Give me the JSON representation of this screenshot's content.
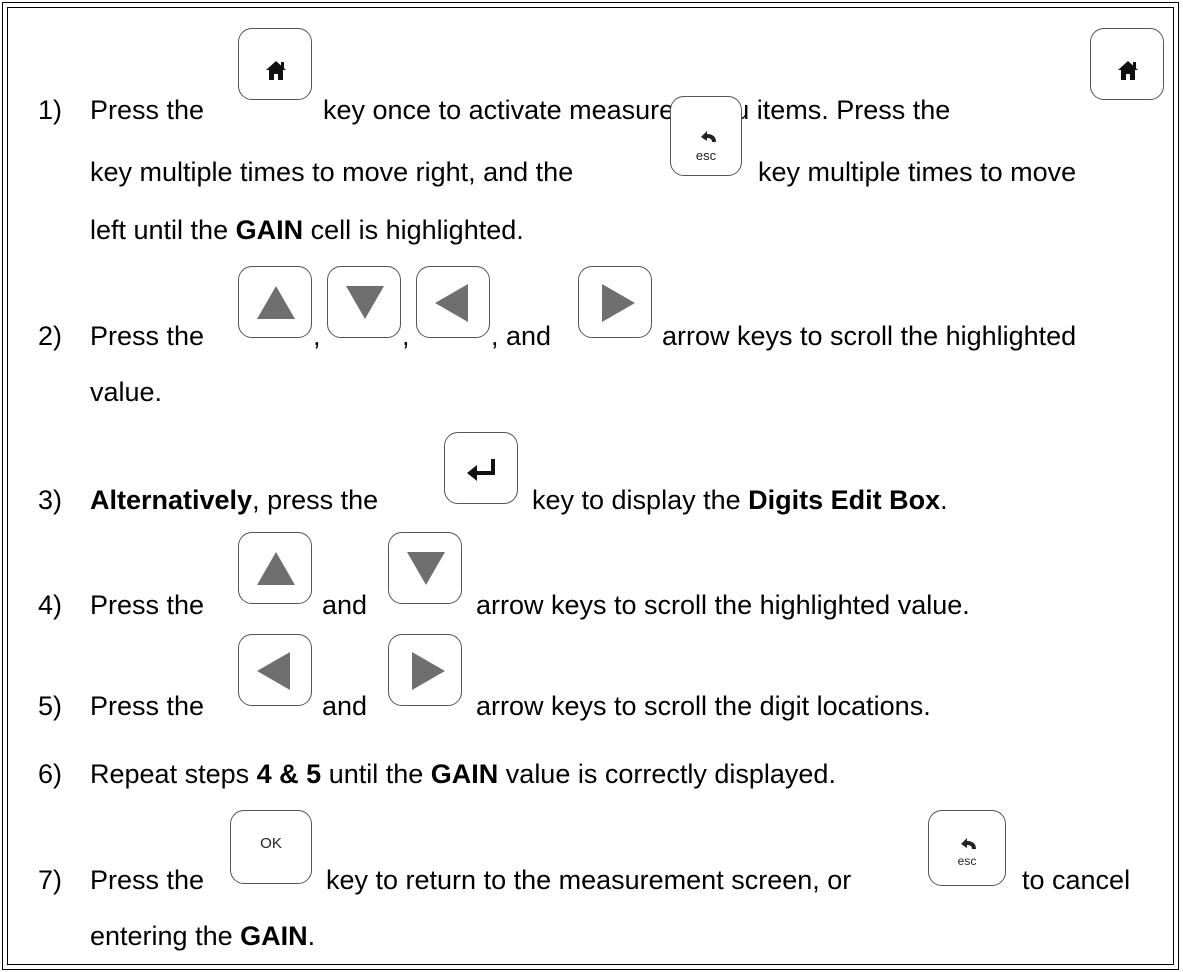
{
  "steps": [
    {
      "num": "1)",
      "a": "Press the",
      "b": "key once to activate measure menu items.  Press the",
      "c": "key multiple times to move right, and the",
      "d": "key multiple times to move",
      "e": "left until the",
      "e_bold": "GAIN",
      "f": "cell is highlighted."
    },
    {
      "num": "2)",
      "a": "Press the",
      "sep1": ",",
      "sep2": ",",
      "sep3": ", and",
      "b": "arrow keys to scroll the highlighted",
      "c": "value."
    },
    {
      "num": "3)",
      "a_bold": "Alternatively",
      "a": ", press the",
      "b": "key to display the",
      "b_bold": "Digits Edit Box",
      "c": "."
    },
    {
      "num": "4)",
      "a": "Press the",
      "and": "and",
      "b": "arrow keys to scroll the highlighted value."
    },
    {
      "num": "5)",
      "a": "Press the",
      "and": "and",
      "b": "arrow keys to scroll the digit locations."
    },
    {
      "num": "6)",
      "a": "Repeat steps",
      "a_bold": "4 & 5",
      "b": "until the",
      "b_bold": "GAIN",
      "c": "value is correctly displayed."
    },
    {
      "num": "7)",
      "a": "Press the",
      "b": "key to return to the measurement screen, or",
      "c": "to cancel",
      "d": "entering the",
      "d_bold": "GAIN",
      "e": "."
    }
  ],
  "keys": {
    "ok_label": "OK",
    "esc_label": "esc",
    "icons": [
      "home-icon",
      "esc-back-icon",
      "up-arrow-icon",
      "down-arrow-icon",
      "left-arrow-icon",
      "right-arrow-icon",
      "enter-icon"
    ]
  }
}
